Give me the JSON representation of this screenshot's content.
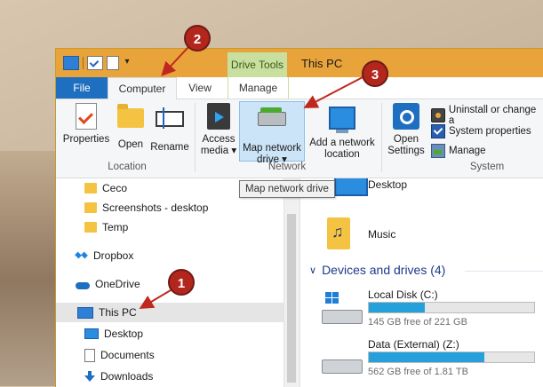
{
  "window": {
    "title": "This PC",
    "context_tab": "Drive Tools"
  },
  "tabs": [
    {
      "label": "File",
      "active": false
    },
    {
      "label": "Computer",
      "active": true
    },
    {
      "label": "View",
      "active": false
    },
    {
      "label": "Manage",
      "active": false
    }
  ],
  "ribbon": {
    "location": {
      "label": "Location",
      "properties": "Properties",
      "open": "Open",
      "rename": "Rename"
    },
    "network": {
      "label": "Network",
      "access_media_1": "Access",
      "access_media_2": "media ▾",
      "map_drive_1": "Map network",
      "map_drive_2": "drive ▾",
      "add_location_1": "Add a network",
      "add_location_2": "location"
    },
    "system": {
      "label": "System",
      "open_settings_1": "Open",
      "open_settings_2": "Settings",
      "uninstall": "Uninstall or change a",
      "system_properties": "System properties",
      "manage": "Manage"
    }
  },
  "tooltip": "Map network drive",
  "nav_pane": [
    {
      "label": "Ceco",
      "icon": "folder-icon"
    },
    {
      "label": "Screenshots - desktop",
      "icon": "folder-icon"
    },
    {
      "label": "Temp",
      "icon": "folder-icon"
    },
    {
      "label": "Dropbox",
      "icon": "dropbox-icon"
    },
    {
      "label": "OneDrive",
      "icon": "onedrive-icon"
    },
    {
      "label": "This PC",
      "icon": "computer-icon",
      "selected": true
    },
    {
      "label": "Desktop",
      "icon": "desktop-icon"
    },
    {
      "label": "Documents",
      "icon": "documents-icon"
    },
    {
      "label": "Downloads",
      "icon": "downloads-icon"
    }
  ],
  "content": {
    "folders": [
      {
        "label": "Desktop"
      },
      {
        "label": "Music"
      }
    ],
    "devices_heading": "Devices and drives (4)",
    "drives": [
      {
        "name": "Local Disk (C:)",
        "free_text": "145 GB free of 221 GB",
        "used_fraction": 0.34
      },
      {
        "name": "Data (External) (Z:)",
        "free_text": "562 GB free of 1.81 TB",
        "used_fraction": 0.7
      }
    ]
  },
  "annotations": [
    "1",
    "2",
    "3"
  ],
  "colors": {
    "titlebar": "#e8a33a",
    "file_tab": "#1f6fc1",
    "context_tab": "#c8dfa0",
    "annotation": "#b3261e",
    "drive_bar": "#26a0da"
  }
}
